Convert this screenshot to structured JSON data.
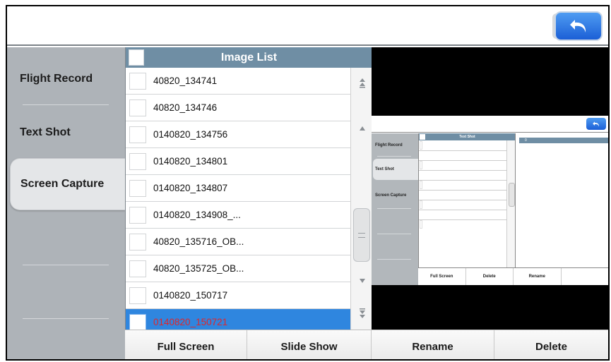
{
  "topbar": {
    "back_icon": "undo-arrow-icon"
  },
  "sidebar": {
    "items": [
      {
        "label": "Flight Record",
        "active": false
      },
      {
        "label": "Text Shot",
        "active": false
      },
      {
        "label": "Screen Capture",
        "active": true
      }
    ]
  },
  "list": {
    "header": "Image List",
    "rows": [
      {
        "label": "40820_134741",
        "selected": false
      },
      {
        "label": "40820_134746",
        "selected": false
      },
      {
        "label": "0140820_134756",
        "selected": false
      },
      {
        "label": "0140820_134801",
        "selected": false
      },
      {
        "label": "0140820_134807",
        "selected": false
      },
      {
        "label": "0140820_134908_...",
        "selected": false
      },
      {
        "label": "40820_135716_OB...",
        "selected": false
      },
      {
        "label": "40820_135725_OB...",
        "selected": false
      },
      {
        "label": "0140820_150717",
        "selected": false
      },
      {
        "label": "0140820_150721",
        "selected": true
      }
    ],
    "scroll_icons": [
      "double-up-arrow-icon",
      "up-arrow-icon",
      "down-arrow-icon",
      "double-down-arrow-icon"
    ]
  },
  "preview": {
    "sidebar": [
      "Flight Record",
      "Text Shot",
      "Screen Capture"
    ],
    "list_header": "Text Shot",
    "right_value": "0",
    "buttons": [
      "Full Screen",
      "Delete",
      "Rename"
    ]
  },
  "bottom": {
    "full_screen": "Full Screen",
    "slide_show": "Slide Show",
    "rename": "Rename",
    "delete": "Delete"
  },
  "colors": {
    "sidebar_bg": "#aeb3b8",
    "header_bg": "#6f8ea4",
    "selected_row_bg": "#2f86df",
    "selected_row_text": "#e0262a",
    "back_button": "#2b73e0"
  }
}
